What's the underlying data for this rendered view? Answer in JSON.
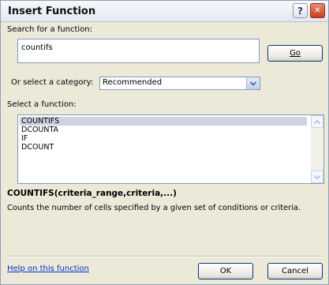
{
  "dialog": {
    "title": "Insert Function",
    "help_button": "?",
    "close_button": "✕"
  },
  "search": {
    "label": "Search for a function:",
    "value": "countifs",
    "go_label": "Go"
  },
  "category": {
    "label": "Or select a category:",
    "selected": "Recommended"
  },
  "functions": {
    "label": "Select a function:",
    "items": [
      "COUNTIFS",
      "DCOUNTA",
      "IF",
      "DCOUNT"
    ]
  },
  "signature": "COUNTIFS(criteria_range,criteria,...)",
  "description": "Counts the number of cells specified by a given set of conditions or criteria.",
  "footer": {
    "help_link": "Help on this function",
    "ok_label": "OK",
    "cancel_label": "Cancel"
  }
}
